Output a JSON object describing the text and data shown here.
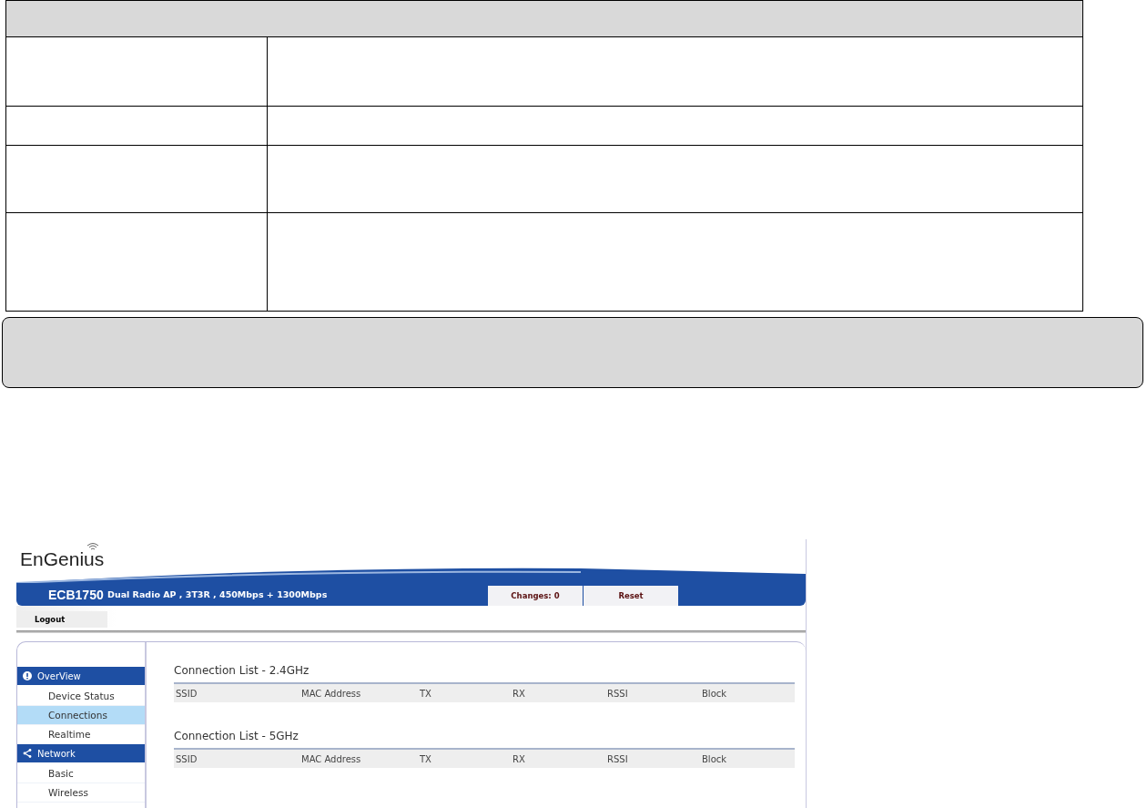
{
  "app": {
    "brand": "EnGenius",
    "model": "ECB1750",
    "subtitle": "Dual Radio AP , 3T3R , 450Mbps + 1300Mbps",
    "buttons": [
      "Changes: 0",
      "Reset"
    ],
    "logout": "Logout"
  },
  "sidebar": {
    "sections": [
      {
        "title": "OverView",
        "items": [
          {
            "label": "Device Status",
            "selected": false
          },
          {
            "label": "Connections",
            "selected": true
          },
          {
            "label": "Realtime",
            "selected": false
          }
        ]
      },
      {
        "title": "Network",
        "items": [
          {
            "label": "Basic",
            "selected": false
          },
          {
            "label": "Wireless",
            "selected": false
          }
        ]
      }
    ]
  },
  "lists": [
    {
      "title": "Connection List - 2.4GHz",
      "columns": [
        "SSID",
        "MAC Address",
        "TX",
        "RX",
        "RSSI",
        "Block"
      ]
    },
    {
      "title": "Connection List - 5GHz",
      "columns": [
        "SSID",
        "MAC Address",
        "TX",
        "RX",
        "RSSI",
        "Block"
      ]
    }
  ]
}
